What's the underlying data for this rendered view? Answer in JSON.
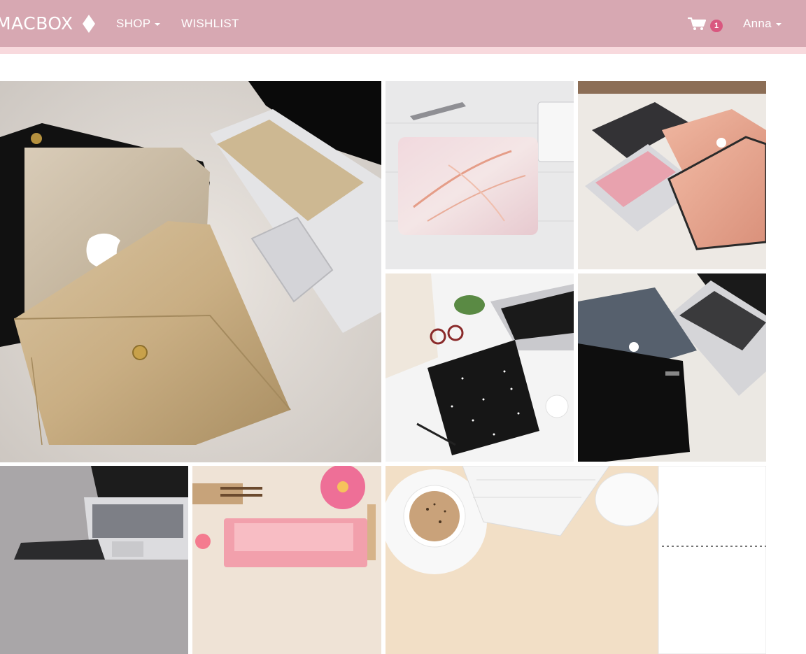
{
  "navbar": {
    "brand": "MACBOX",
    "brand_icon": "diamond-icon",
    "shop_label": "SHOP",
    "wishlist_label": "WISHLIST",
    "cart_icon": "cart-icon",
    "cart_count": "1",
    "user_name": "Anna"
  },
  "colors": {
    "navbar_bg": "#d7a8b2",
    "navbar_stripe": "#f8d9dd",
    "badge_bg": "#d9577f",
    "text_on_nav": "#ffffff"
  },
  "gallery": {
    "tiles": [
      {
        "subject": "gold glitter laptop case with gold leather envelope sleeve on white fur"
      },
      {
        "subject": "pink marble laptop case on white wood with pen and keyboard"
      },
      {
        "subject": "rose gold glitter case and sleeve with pink keyboard cover on fur"
      },
      {
        "subject": "black speckled laptop sleeve with glasses, plant and macbook on white desk"
      },
      {
        "subject": "black leather sleeve and grey glitter case with macbook on fur"
      },
      {
        "subject": "macbook with grey keyboard cover on grey fur"
      },
      {
        "subject": "pink watercolor laptop skin with flower and brushes"
      },
      {
        "subject": "coffee cup, keyboard, mouse and notebook on light wood"
      }
    ]
  }
}
